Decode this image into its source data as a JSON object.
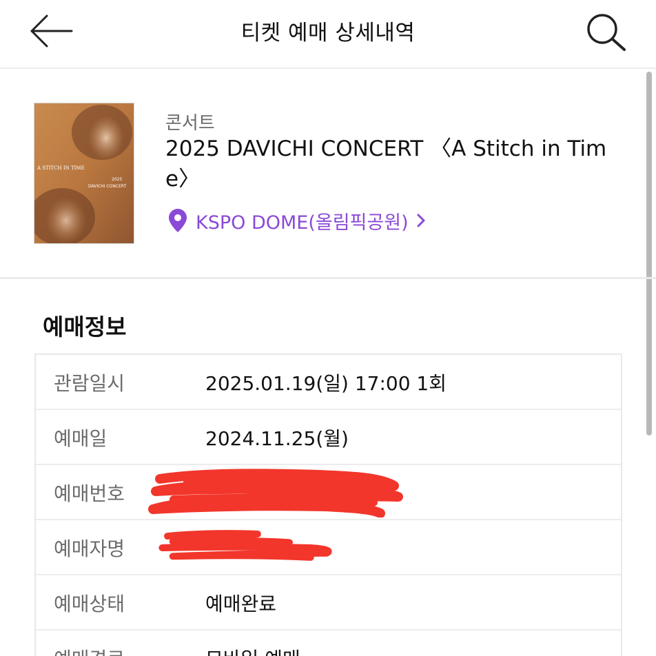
{
  "header": {
    "title": "티켓 예매 상세내역",
    "back_icon": "arrow-left-icon",
    "search_icon": "search-icon"
  },
  "event": {
    "category": "콘서트",
    "title": "2025 DAVICHI CONCERT 〈A Stitch in Time〉",
    "venue": "KSPO DOME(올림픽공원)",
    "venue_icon": "location-pin-icon",
    "poster": {
      "text_line1": "A STITCH IN TIME",
      "text_line2": "2025",
      "text_line3": "DAVICHI CONCERT"
    }
  },
  "booking_info": {
    "section_title": "예매정보",
    "rows": [
      {
        "label": "관람일시",
        "value": "2025.01.19(일) 17:00 1회"
      },
      {
        "label": "예매일",
        "value": "2024.11.25(월)"
      },
      {
        "label": "예매번호",
        "value": ""
      },
      {
        "label": "예매자명",
        "value": ""
      },
      {
        "label": "예매상태",
        "value": "예매완료"
      },
      {
        "label": "예매경로",
        "value": "모바일 예매"
      }
    ]
  },
  "colors": {
    "accent": "#8a49d6",
    "redaction": "#f2362b",
    "label": "#6b6b6b",
    "divider": "#ebebeb"
  }
}
